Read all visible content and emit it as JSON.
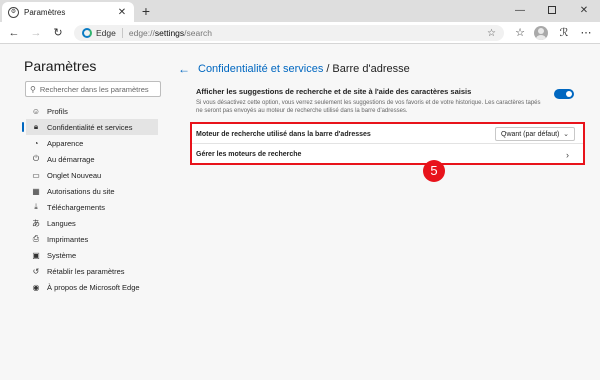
{
  "window": {
    "tab_title": "Paramètres",
    "tab_close": "✕",
    "new_tab": "+",
    "min": "—",
    "close": "✕"
  },
  "toolbar": {
    "brand": "Edge",
    "url_scheme": "edge://",
    "url_host": "settings",
    "url_path": "/search",
    "back": "←",
    "forward": "→",
    "reload": "↻",
    "star": "☆",
    "collections": "☆",
    "more": "⋯"
  },
  "sidebar": {
    "title": "Paramètres",
    "search_placeholder": "Rechercher dans les paramètres",
    "items": [
      {
        "label": "Profils",
        "icon": "profile-icon"
      },
      {
        "label": "Confidentialité et services",
        "icon": "lock-icon"
      },
      {
        "label": "Apparence",
        "icon": "appearance-icon"
      },
      {
        "label": "Au démarrage",
        "icon": "power-icon"
      },
      {
        "label": "Onglet Nouveau",
        "icon": "new-tab-icon"
      },
      {
        "label": "Autorisations du site",
        "icon": "site-permissions-icon"
      },
      {
        "label": "Téléchargements",
        "icon": "download-icon"
      },
      {
        "label": "Langues",
        "icon": "language-icon"
      },
      {
        "label": "Imprimantes",
        "icon": "printer-icon"
      },
      {
        "label": "Système",
        "icon": "system-icon"
      },
      {
        "label": "Rétablir les paramètres",
        "icon": "reset-icon"
      },
      {
        "label": "À propos de Microsoft Edge",
        "icon": "edge-logo-icon"
      }
    ]
  },
  "main": {
    "back_arrow": "←",
    "breadcrumb_parent": "Confidentialité et services",
    "breadcrumb_sep": "/",
    "breadcrumb_current": "Barre d'adresse",
    "suggestions_title": "Afficher les suggestions de recherche et de site à l'aide des caractères saisis",
    "suggestions_desc": "Si vous désactivez cette option, vous verrez seulement les suggestions de vos favoris et de votre historique. Les caractères tapés ne seront pas envoyés au moteur de recherche utilisé dans la barre d'adresses.",
    "suggestions_enabled": true,
    "engine_label": "Moteur de recherche utilisé dans la barre d'adresses",
    "engine_value": "Qwant (par défaut)",
    "manage_label": "Gérer les moteurs de recherche",
    "step_badge": "5"
  },
  "colors": {
    "accent": "#0067c0",
    "highlight": "#e8131b"
  }
}
